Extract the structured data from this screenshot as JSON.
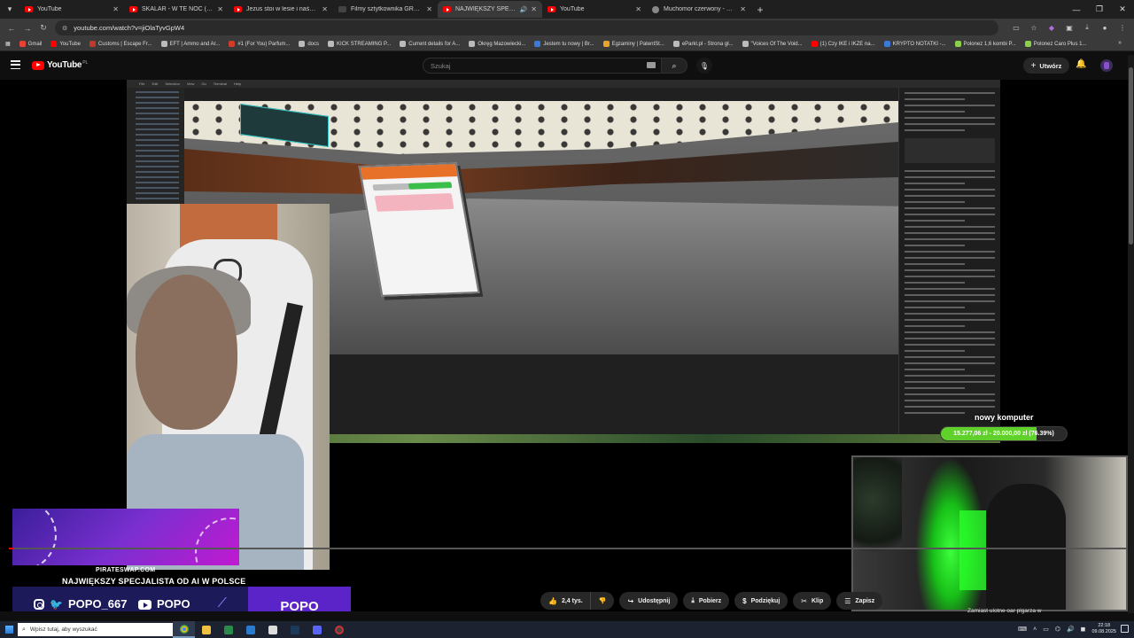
{
  "browser": {
    "tabs": [
      {
        "label": "YouTube",
        "icon": "youtube-icon",
        "active": false
      },
      {
        "label": "SKALAR - W TE NOC ( HIT Disc",
        "icon": "youtube-icon",
        "active": false
      },
      {
        "label": "Jezus stoi w lesie i naśmiewa si",
        "icon": "youtube-icon",
        "active": false
      },
      {
        "label": "Filmy sztytkownika GRZESIU.PL",
        "icon": "generic-icon",
        "active": false
      },
      {
        "label": "NAJWIĘKSZY SPECJALISTA",
        "icon": "youtube-icon",
        "active": true
      },
      {
        "label": "YouTube",
        "icon": "youtube-icon",
        "active": false
      },
      {
        "label": "Muchomor czerwony - Szukaj z",
        "icon": "google-icon",
        "active": false
      }
    ],
    "url": "youtube.com/watch?v=jiOlaTyvGpW4",
    "bookmarks": [
      {
        "label": "Gmail",
        "color": "#ea4335"
      },
      {
        "label": "YouTube",
        "color": "#ff0000"
      },
      {
        "label": "Customs | Escape Fr...",
        "color": "#c0392b"
      },
      {
        "label": "EFT | Ammo and Ar...",
        "color": "#bbbbbb"
      },
      {
        "label": "#1 (For You) Parfum...",
        "color": "#d23c2a"
      },
      {
        "label": "docs",
        "color": "#bbbbbb"
      },
      {
        "label": "KICK STREAMING P...",
        "color": "#bbbbbb"
      },
      {
        "label": "Current details for A...",
        "color": "#bbbbbb"
      },
      {
        "label": "Okręg Mazowiecki...",
        "color": "#bbbbbb"
      },
      {
        "label": "Jestem tu nowy | Br...",
        "color": "#3b7ad8"
      },
      {
        "label": "Egzaminy | PatentSt...",
        "color": "#e8a32a"
      },
      {
        "label": "eParkl.pl - Strona gł...",
        "color": "#bbbbbb"
      },
      {
        "label": "\"Voices Of The Void...",
        "color": "#bbbbbb"
      },
      {
        "label": "(1) Czy IKE i IKZE na...",
        "color": "#ff0000"
      },
      {
        "label": "KRYPTO NOTATKI -...",
        "color": "#3b7ad8"
      },
      {
        "label": "Polonez 1,6 kombi P...",
        "color": "#8ad04a"
      },
      {
        "label": "Polonez Caro Plus 1...",
        "color": "#8ad04a"
      }
    ]
  },
  "youtube": {
    "logo_text": "YouTube",
    "region": "PL",
    "search_placeholder": "Szukaj",
    "create_label": "Utwórz"
  },
  "video": {
    "donation_title": "nowy komputer",
    "donation_text": "15.277,06 zł - 20.000,00 zł (76.39%)",
    "donation_progress": 0.7639,
    "overlay_site": "PIRATESWAP.COM",
    "overlay_headline": "NAJWIĘKSZY SPECJALISTA OD AI W POLSCE",
    "social_handle": "POPO_667",
    "youtube_name": "POPO",
    "brand_name": "POPO"
  },
  "actions": {
    "likes": "2,4 tys.",
    "share": "Udostępnij",
    "download": "Pobierz",
    "thanks": "Podziękuj",
    "clip": "Klip",
    "save": "Zapisz"
  },
  "recommendation_snippet": "Zamiast ulotne oar plgarza w",
  "taskbar": {
    "search_placeholder": "Wpisz tutaj, aby wyszukać",
    "time": "22:18",
    "date": "09.08.2025"
  }
}
